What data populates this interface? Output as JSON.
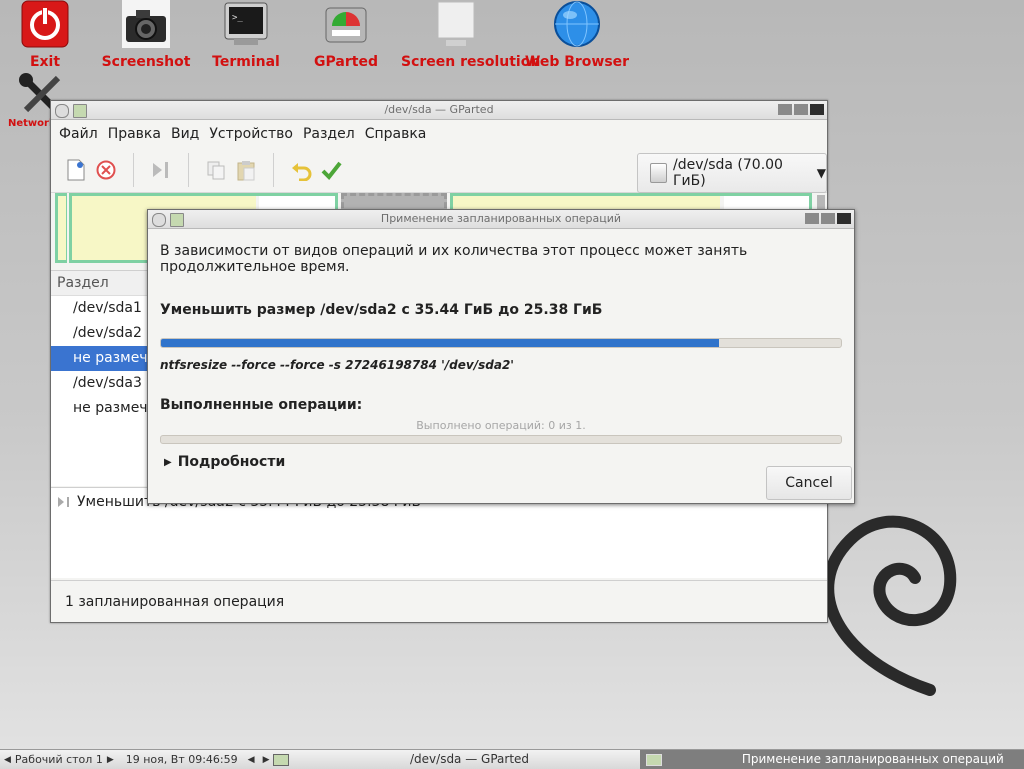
{
  "desktop": {
    "icons": [
      {
        "label": "Exit",
        "icon": "power-icon",
        "color": "#d21010"
      },
      {
        "label": "Screenshot",
        "icon": "camera-icon"
      },
      {
        "label": "Terminal",
        "icon": "terminal-icon"
      },
      {
        "label": "GParted",
        "icon": "gparted-icon"
      },
      {
        "label": "Screen resolution",
        "icon": "monitor-icon"
      },
      {
        "label": "Web Browser",
        "icon": "globe-icon"
      },
      {
        "label": "Network",
        "icon": "wrench-screwdriver-icon"
      }
    ],
    "label_color": "#d21010"
  },
  "main_window": {
    "title": "/dev/sda — GParted",
    "menu": [
      "Файл",
      "Правка",
      "Вид",
      "Устройство",
      "Раздел",
      "Справка"
    ],
    "device": "/dev/sda (70.00 ГиБ)",
    "partitions_header": "Раздел",
    "partitions": [
      "/dev/sda1",
      "/dev/sda2",
      "не размечено",
      "/dev/sda3",
      "не размечено"
    ],
    "selected_index": 2,
    "pending_operation": "Уменьшить /dev/sda2 с 35.44 ГиБ до 25.38 ГиБ",
    "status": "1 запланированная операция",
    "accent": "#3a74d0"
  },
  "dialog": {
    "title": "Применение запланированных операций",
    "intro": "В зависимости от видов операций и их количества этот процесс может занять продолжительное время.",
    "operation_title": "Уменьшить размер /dev/sda2 с 35.44 ГиБ до 25.38 ГиБ",
    "operation_progress": 0.82,
    "command": "ntfsresize --force --force -s 27246198784 '/dev/sda2'",
    "completed_header": "Выполненные операции:",
    "completed_text": "Выполнено операций: 0 из 1.",
    "completed_progress": 0,
    "details_label": "Подробности",
    "cancel_label": "Cancel",
    "progress_color": "#2f73cb"
  },
  "taskbar": {
    "desktop": "Рабочий стол 1",
    "clock": "19 ноя, Вт 09:46:59",
    "tasks": [
      "/dev/sda — GParted",
      "Применение запланированных операций"
    ]
  }
}
